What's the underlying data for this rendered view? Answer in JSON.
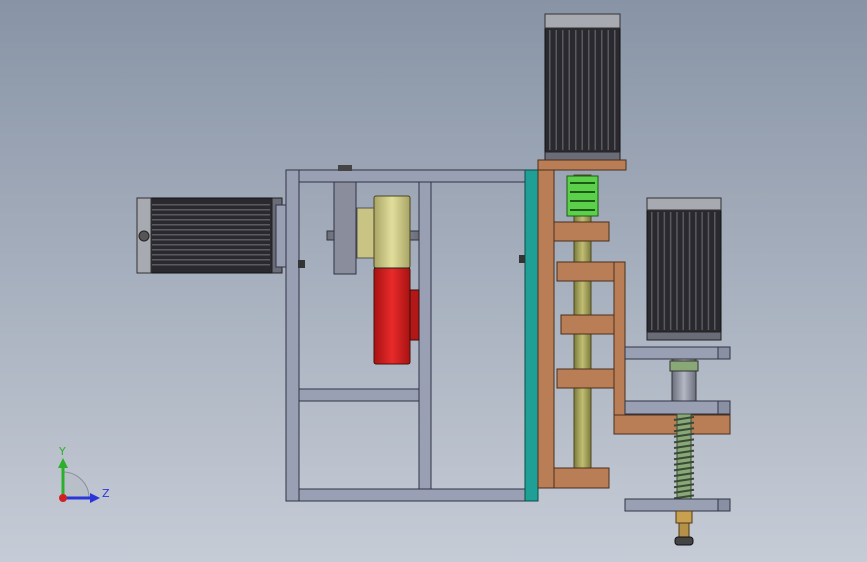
{
  "viewport": {
    "background_top": "#8894a6",
    "background_bottom": "#c6ccd6"
  },
  "palette": {
    "frame_fill": "#9aa0b4",
    "frame_edge": "#2f3344",
    "motor_body": "#2a2a2e",
    "motor_fin": "#5a5a62",
    "motor_cap": "#a8aab2",
    "pulley_gold": "#c9c483",
    "pulley_red": "#d41e1e",
    "plate_teal": "#1fa096",
    "wood": "#b97e55",
    "shaft_olive": "#9c9a55",
    "coupling_green": "#5cd04a",
    "spring_green": "#88a878"
  },
  "triad": {
    "y_label": "Y",
    "z_label": "Z",
    "y_color": "#2bb02b",
    "z_color": "#2a36d8",
    "x_color": "#d02020"
  }
}
